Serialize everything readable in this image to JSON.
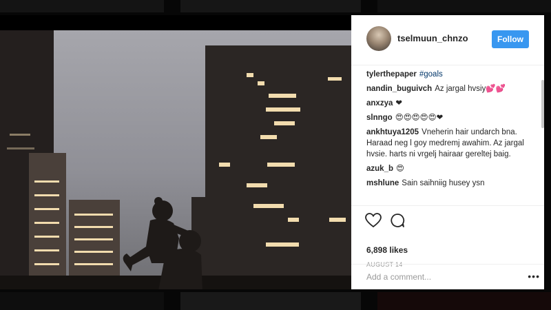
{
  "post": {
    "author": "tselmuun_chnzo",
    "follow_label": "Follow",
    "comments": [
      {
        "user": "tylerthepaper",
        "text": "",
        "tag": "#goals"
      },
      {
        "user": "nandin_buguivch",
        "text": "Az jargal hvsiy💕💕",
        "tag": ""
      },
      {
        "user": "anxzya",
        "text": "❤",
        "tag": ""
      },
      {
        "user": "slnngo",
        "text": "😍😍😍😍😍❤",
        "tag": ""
      },
      {
        "user": "ankhtuya1205",
        "text": "Vneherin hair undarch bna. Haraad neg l goy medremj awahim. Az jargal hvsie. harts ni vrgelj hairaar gereltej baig.",
        "tag": ""
      },
      {
        "user": "azuk_b",
        "text": "😍",
        "tag": ""
      },
      {
        "user": "mshlune",
        "text": "Sain saihniig husey ysn",
        "tag": ""
      }
    ],
    "likes": "6,898 likes",
    "date": "AUGUST 14",
    "add_comment_placeholder": "Add a comment...",
    "more_label": "•••"
  },
  "icons": {
    "like": "heart-outline-icon",
    "comment": "speech-bubble-icon"
  },
  "colors": {
    "follow_button": "#3897f0",
    "username": "#262626",
    "hashtag": "#003569"
  }
}
